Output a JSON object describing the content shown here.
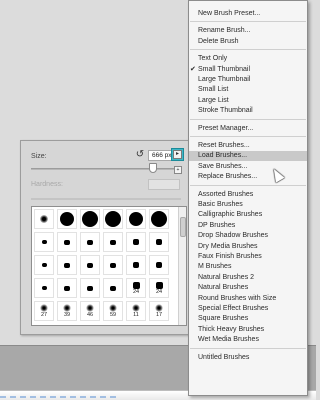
{
  "panel": {
    "size_label": "Size:",
    "size_value": "666 px",
    "hardness_label": "Hardness:",
    "size_slider_fraction": 0.93,
    "flyout_icon": "gear-icon",
    "new_preset_icon": "new-preset-icon",
    "reset_icon": "reset-size-icon"
  },
  "brush_grid": {
    "rows": [
      [
        "",
        "",
        "",
        "",
        "",
        ""
      ],
      [
        "",
        "",
        "",
        "",
        "",
        ""
      ],
      [
        "",
        "",
        "",
        "",
        "",
        ""
      ],
      [
        "",
        "",
        "",
        "",
        "24",
        "24"
      ],
      [
        "27",
        "39",
        "46",
        "59",
        "11",
        "17"
      ]
    ]
  },
  "menu": {
    "items": [
      {
        "label": "New Brush Preset...",
        "checked": false
      },
      {
        "label": "Rename Brush...",
        "checked": false
      },
      {
        "label": "Delete Brush",
        "checked": false
      },
      {
        "label": "Text Only",
        "checked": false
      },
      {
        "label": "Small Thumbnail",
        "checked": true
      },
      {
        "label": "Large Thumbnail",
        "checked": false
      },
      {
        "label": "Small List",
        "checked": false
      },
      {
        "label": "Large List",
        "checked": false
      },
      {
        "label": "Stroke Thumbnail",
        "checked": false
      },
      {
        "label": "Preset Manager...",
        "checked": false
      },
      {
        "label": "Reset Brushes...",
        "checked": false
      },
      {
        "label": "Load Brushes...",
        "checked": false,
        "highlighted": true
      },
      {
        "label": "Save Brushes...",
        "checked": false
      },
      {
        "label": "Replace Brushes...",
        "checked": false
      },
      {
        "label": "Assorted Brushes",
        "checked": false
      },
      {
        "label": "Basic Brushes",
        "checked": false
      },
      {
        "label": "Calligraphic Brushes",
        "checked": false
      },
      {
        "label": "DP Brushes",
        "checked": false
      },
      {
        "label": "Drop Shadow Brushes",
        "checked": false
      },
      {
        "label": "Dry Media Brushes",
        "checked": false
      },
      {
        "label": "Faux Finish Brushes",
        "checked": false
      },
      {
        "label": "M Brushes",
        "checked": false
      },
      {
        "label": "Natural Brushes 2",
        "checked": false
      },
      {
        "label": "Natural Brushes",
        "checked": false
      },
      {
        "label": "Round Brushes with Size",
        "checked": false
      },
      {
        "label": "Special Effect Brushes",
        "checked": false
      },
      {
        "label": "Square Brushes",
        "checked": false
      },
      {
        "label": "Thick Heavy Brushes",
        "checked": false
      },
      {
        "label": "Wet Media Brushes",
        "checked": false
      },
      {
        "label": "Untitled Brushes",
        "checked": false
      }
    ],
    "highlight_color": "#c9c9c9"
  },
  "colors": {
    "flyout_accent": "#3fb7c7",
    "panel_bg": "#d6d6d6",
    "menu_bg": "#f5f5f5"
  }
}
